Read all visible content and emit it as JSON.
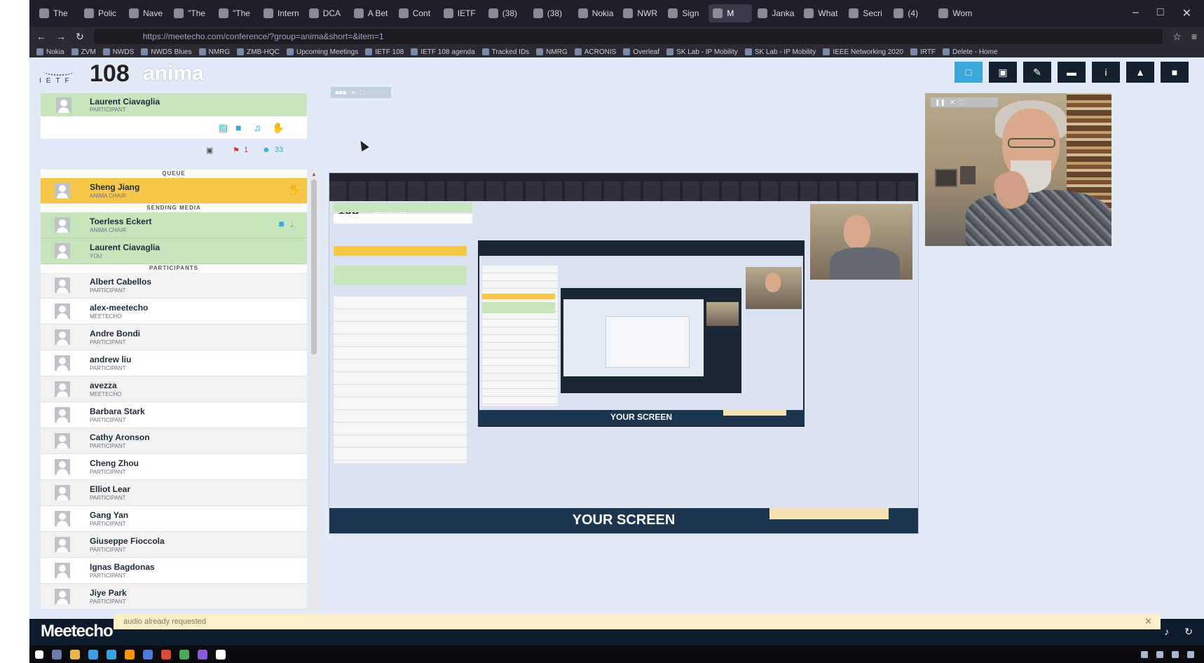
{
  "browser": {
    "tabs": [
      {
        "label": "The"
      },
      {
        "label": "Polic"
      },
      {
        "label": "Nave"
      },
      {
        "label": "\"The"
      },
      {
        "label": "\"The"
      },
      {
        "label": "Intern"
      },
      {
        "label": "DCA"
      },
      {
        "label": "A Bet"
      },
      {
        "label": "Cont"
      },
      {
        "label": "IETF"
      },
      {
        "label": "(38)"
      },
      {
        "label": "(38)"
      },
      {
        "label": "Nokia"
      },
      {
        "label": "NWR"
      },
      {
        "label": "Sign"
      },
      {
        "label": "M"
      },
      {
        "label": "Janka"
      },
      {
        "label": "What"
      },
      {
        "label": "Secri"
      },
      {
        "label": "(4)"
      },
      {
        "label": "Wom"
      }
    ],
    "url": "https://meetecho.com/conference/?group=anima&short=&item=1",
    "bookmarks": [
      "Nokia",
      "ZVM",
      "NWDS",
      "NWDS Blues",
      "NMRG",
      "ZMB-HQC",
      "Upcoming Meetings",
      "IETF 108",
      "IETF 108 agenda",
      "Tracked IDs",
      "NMRG",
      "ACRONIS",
      "Overleaf",
      "SK Lab - IP Mobility",
      "SK Lab - IP Mobility",
      "IEEE Networking 2020",
      "IRTF",
      "Delete - Home"
    ]
  },
  "header": {
    "logo": "IETF",
    "session_number": "108",
    "session_name": "anima",
    "buttons": [
      {
        "icon": "chat-icon",
        "glyph": "□"
      },
      {
        "icon": "layout-icon",
        "glyph": "▣"
      },
      {
        "icon": "edit-icon",
        "glyph": "✎"
      },
      {
        "icon": "folder-icon",
        "glyph": "▬"
      },
      {
        "icon": "info-icon",
        "glyph": "i"
      },
      {
        "icon": "bell-icon",
        "glyph": "▲"
      },
      {
        "icon": "exit-icon",
        "glyph": "■"
      }
    ]
  },
  "me": {
    "name": "Laurent Ciavaglia",
    "role": "PARTICIPANT"
  },
  "counts": {
    "participants": "33",
    "alerts": "1"
  },
  "sections": {
    "queue": "QUEUE",
    "sending": "SENDING MEDIA",
    "participants": "PARTICIPANTS"
  },
  "queue": [
    {
      "name": "Sheng Jiang",
      "role": "ANIMA CHAIR"
    }
  ],
  "sending": [
    {
      "name": "Toerless Eckert",
      "role": "ANIMA CHAIR"
    },
    {
      "name": "Laurent Ciavaglia",
      "role": "YOU"
    }
  ],
  "participants": [
    {
      "name": "Albert Cabellos",
      "role": "PARTICIPANT"
    },
    {
      "name": "alex-meetecho",
      "role": "MEETECHO"
    },
    {
      "name": "Andre Bondi",
      "role": "PARTICIPANT"
    },
    {
      "name": "andrew liu",
      "role": "PARTICIPANT"
    },
    {
      "name": "avezza",
      "role": "MEETECHO"
    },
    {
      "name": "Barbara Stark",
      "role": "PARTICIPANT"
    },
    {
      "name": "Cathy Aronson",
      "role": "PARTICIPANT"
    },
    {
      "name": "Cheng Zhou",
      "role": "PARTICIPANT"
    },
    {
      "name": "Elliot Lear",
      "role": "PARTICIPANT"
    },
    {
      "name": "Gang Yan",
      "role": "PARTICIPANT"
    },
    {
      "name": "Giuseppe Fioccola",
      "role": "PARTICIPANT"
    },
    {
      "name": "Ignas Bagdonas",
      "role": "PARTICIPANT"
    },
    {
      "name": "Jiye Park",
      "role": "PARTICIPANT"
    }
  ],
  "screenshare": {
    "label": "YOUR SCREEN",
    "nested_number": "108",
    "nested_name": "anima",
    "inner_label": "YOUR SCREEN"
  },
  "footer": {
    "logo": "Meetecho",
    "notification": "audio already requested"
  },
  "colors": {
    "accent": "#3aa7d8",
    "queue": "#f5c84a",
    "sending": "#c6e5bd",
    "dark": "#0e1b2c"
  }
}
